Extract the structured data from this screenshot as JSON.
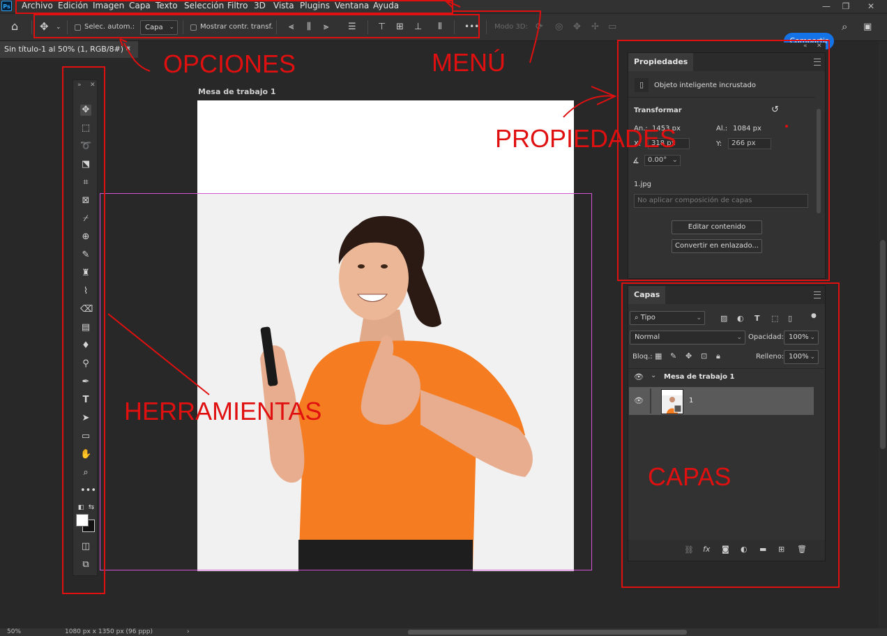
{
  "app": {
    "logo": "Ps"
  },
  "menu": {
    "items": [
      "Archivo",
      "Edición",
      "Imagen",
      "Capa",
      "Texto",
      "Selección",
      "Filtro",
      "3D",
      "Vista",
      "Plugins",
      "Ventana",
      "Ayuda"
    ]
  },
  "window_controls": {
    "minimize": "—",
    "restore": "❐",
    "close": "✕"
  },
  "options_bar": {
    "auto_select_label": "Selec. autom.:",
    "auto_select_value": "Capa",
    "show_transform_label": "Mostrar contr. transf.",
    "more": "•••",
    "mode_3d": "Modo 3D:",
    "share": "Compartir"
  },
  "document": {
    "tab_title": "Sin título-1 al 50% (1, RGB/8#) *",
    "tab_close": "✕",
    "artboard_name": "Mesa de trabajo 1"
  },
  "properties": {
    "tab": "Propiedades",
    "object_type": "Objeto inteligente incrustado",
    "transform_label": "Transformar",
    "width_label": "An.:",
    "width_value": "1453 px",
    "height_label": "Al.:",
    "height_value": "1084 px",
    "x_label": "X:",
    "x_value": "318 px",
    "y_label": "Y:",
    "y_value": "266 px",
    "angle_value": "0.00°",
    "filename": "1.jpg",
    "comp_placeholder": "No aplicar composición de capas",
    "edit_button": "Editar contenido",
    "convert_button": "Convertir en enlazado..."
  },
  "layers": {
    "tab": "Capas",
    "filter_type": "Tipo",
    "blend_mode": "Normal",
    "opacity_label": "Opacidad:",
    "opacity_value": "100%",
    "lock_label": "Bloq.:",
    "fill_label": "Relleno:",
    "fill_value": "100%",
    "group_name": "Mesa de trabajo 1",
    "layer_name": "1"
  },
  "statusbar": {
    "zoom": "50%",
    "doc_info": "1080 px x 1350 px (96 ppp)"
  },
  "annotations": {
    "opciones": "OPCIONES",
    "menu": "MENÚ",
    "propiedades": "PROPIEDADES",
    "herramientas": "HERRAMIENTAS",
    "capas": "CAPAS",
    "color": "#e01010"
  }
}
